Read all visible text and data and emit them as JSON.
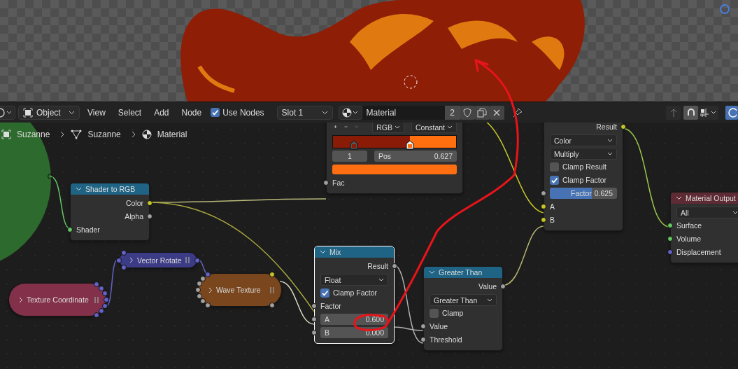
{
  "header": {
    "object_mode": "Object",
    "menus": [
      "View",
      "Select",
      "Add",
      "Node"
    ],
    "use_nodes": {
      "label": "Use Nodes",
      "checked": true
    },
    "slot": "Slot 1",
    "material": {
      "name": "Material",
      "users": "2"
    }
  },
  "breadcrumbs": [
    {
      "kind": "object",
      "label": "Suzanne"
    },
    {
      "kind": "mesh",
      "label": "Suzanne"
    },
    {
      "kind": "material",
      "label": "Material"
    }
  ],
  "nodes": [
    {
      "kind": "full",
      "selected": false,
      "rows": [
        {
          "kind": "ramp_tools",
          "mode": "RGB",
          "interpolation": "Constant"
        },
        {
          "kind": "ramp",
          "stops": [
            {
              "color": "#8a1b06",
              "level": 0.17,
              "selected": false
            },
            {
              "color": "#ff6f0f",
              "level": 0.627,
              "selected": true
            }
          ]
        },
        {
          "kind": "stop_fields",
          "index": "1",
          "label": "Pos",
          "value": "0.627"
        },
        {
          "kind": "swatch",
          "color": "#ff6f12"
        },
        {
          "kind": "input",
          "label": "Fac",
          "color": "#a1a1a1"
        }
      ]
    },
    {
      "kind": "full",
      "selected": false,
      "rows": [
        {
          "kind": "output",
          "label": "Result",
          "color": "#c7c729"
        },
        {
          "kind": "dropdown",
          "value": "Color"
        },
        {
          "kind": "dropdown",
          "value": "Multiply"
        },
        {
          "kind": "checkbox",
          "label": "Clamp Result",
          "checked": false
        },
        {
          "kind": "checkbox",
          "label": "Clamp Factor",
          "checked": true
        },
        {
          "kind": "slider",
          "label": "Factor",
          "value": "0.625",
          "level": 0.625,
          "color": "#a1a1a1"
        },
        {
          "kind": "input",
          "label": "A",
          "color": "#c7c729"
        },
        {
          "kind": "input",
          "label": "B",
          "color": "#c7c729"
        }
      ]
    },
    {
      "kind": "full",
      "title": "Shader to RGB",
      "color": "#1f6485",
      "selected": false,
      "rows": [
        {
          "kind": "output",
          "label": "Color",
          "color": "#c7c729"
        },
        {
          "kind": "output",
          "label": "Alpha",
          "color": "#a1a1a1"
        },
        {
          "kind": "input",
          "label": "Shader",
          "color": "#63c763"
        }
      ]
    },
    {
      "kind": "full",
      "title": "Material Output",
      "color": "#5e2a33",
      "selected": false,
      "rows": [
        {
          "kind": "dropdown",
          "value": "All"
        },
        {
          "kind": "input",
          "label": "Surface",
          "color": "#63c763"
        },
        {
          "kind": "input",
          "label": "Volume",
          "color": "#63c763"
        },
        {
          "kind": "input",
          "label": "Displacement",
          "color": "#6363c7"
        }
      ]
    },
    {
      "kind": "collapsed",
      "title": "Vector Rotate",
      "color": "#3c3b86",
      "selected": false,
      "inputs": [
        {
          "color": "#6363c7"
        },
        {
          "color": "#6363c7"
        },
        {
          "color": "#6363c7"
        }
      ],
      "outputs": [
        {
          "color": "#6363c7"
        }
      ]
    },
    {
      "kind": "collapsed",
      "title": "Wave Texture",
      "color": "#79461d",
      "selected": false,
      "inputs": [
        {
          "color": "#6363c7"
        },
        {
          "color": "#a1a1a1"
        },
        {
          "color": "#a1a1a1"
        },
        {
          "color": "#a1a1a1"
        },
        {
          "color": "#a1a1a1"
        },
        {
          "color": "#a1a1a1"
        },
        {
          "color": "#a1a1a1"
        }
      ],
      "outputs": [
        {
          "color": "#c7c729"
        },
        {
          "color": "#a1a1a1"
        }
      ]
    },
    {
      "kind": "collapsed",
      "title": "Texture Coordinate",
      "color": "#83314a",
      "selected": false,
      "outputs": [
        {
          "color": "#6363c7"
        },
        {
          "color": "#6363c7"
        },
        {
          "color": "#6363c7"
        },
        {
          "color": "#6363c7"
        },
        {
          "color": "#6363c7"
        },
        {
          "color": "#6363c7"
        },
        {
          "color": "#6363c7"
        }
      ]
    },
    {
      "kind": "full",
      "title": "Mix",
      "color": "#1f6485",
      "selected": true,
      "rows": [
        {
          "kind": "output",
          "label": "Result",
          "color": "#a1a1a1"
        },
        {
          "kind": "dropdown",
          "value": "Float"
        },
        {
          "kind": "checkbox",
          "label": "Clamp Factor",
          "checked": true
        },
        {
          "kind": "input",
          "label": "Factor",
          "color": "#a1a1a1"
        },
        {
          "kind": "field",
          "label": "A",
          "value": "0.600",
          "color": "#a1a1a1"
        },
        {
          "kind": "field",
          "label": "B",
          "value": "0.000",
          "color": "#a1a1a1"
        }
      ]
    },
    {
      "kind": "full",
      "title": "Greater Than",
      "color": "#1f6485",
      "selected": false,
      "rows": [
        {
          "kind": "output",
          "label": "Value",
          "color": "#a1a1a1"
        },
        {
          "kind": "dropdown",
          "value": "Greater Than"
        },
        {
          "kind": "checkbox",
          "label": "Clamp",
          "checked": false
        },
        {
          "kind": "input",
          "label": "Value",
          "color": "#a1a1a1"
        },
        {
          "kind": "input",
          "label": "Threshold",
          "color": "#a1a1a1"
        }
      ]
    }
  ]
}
